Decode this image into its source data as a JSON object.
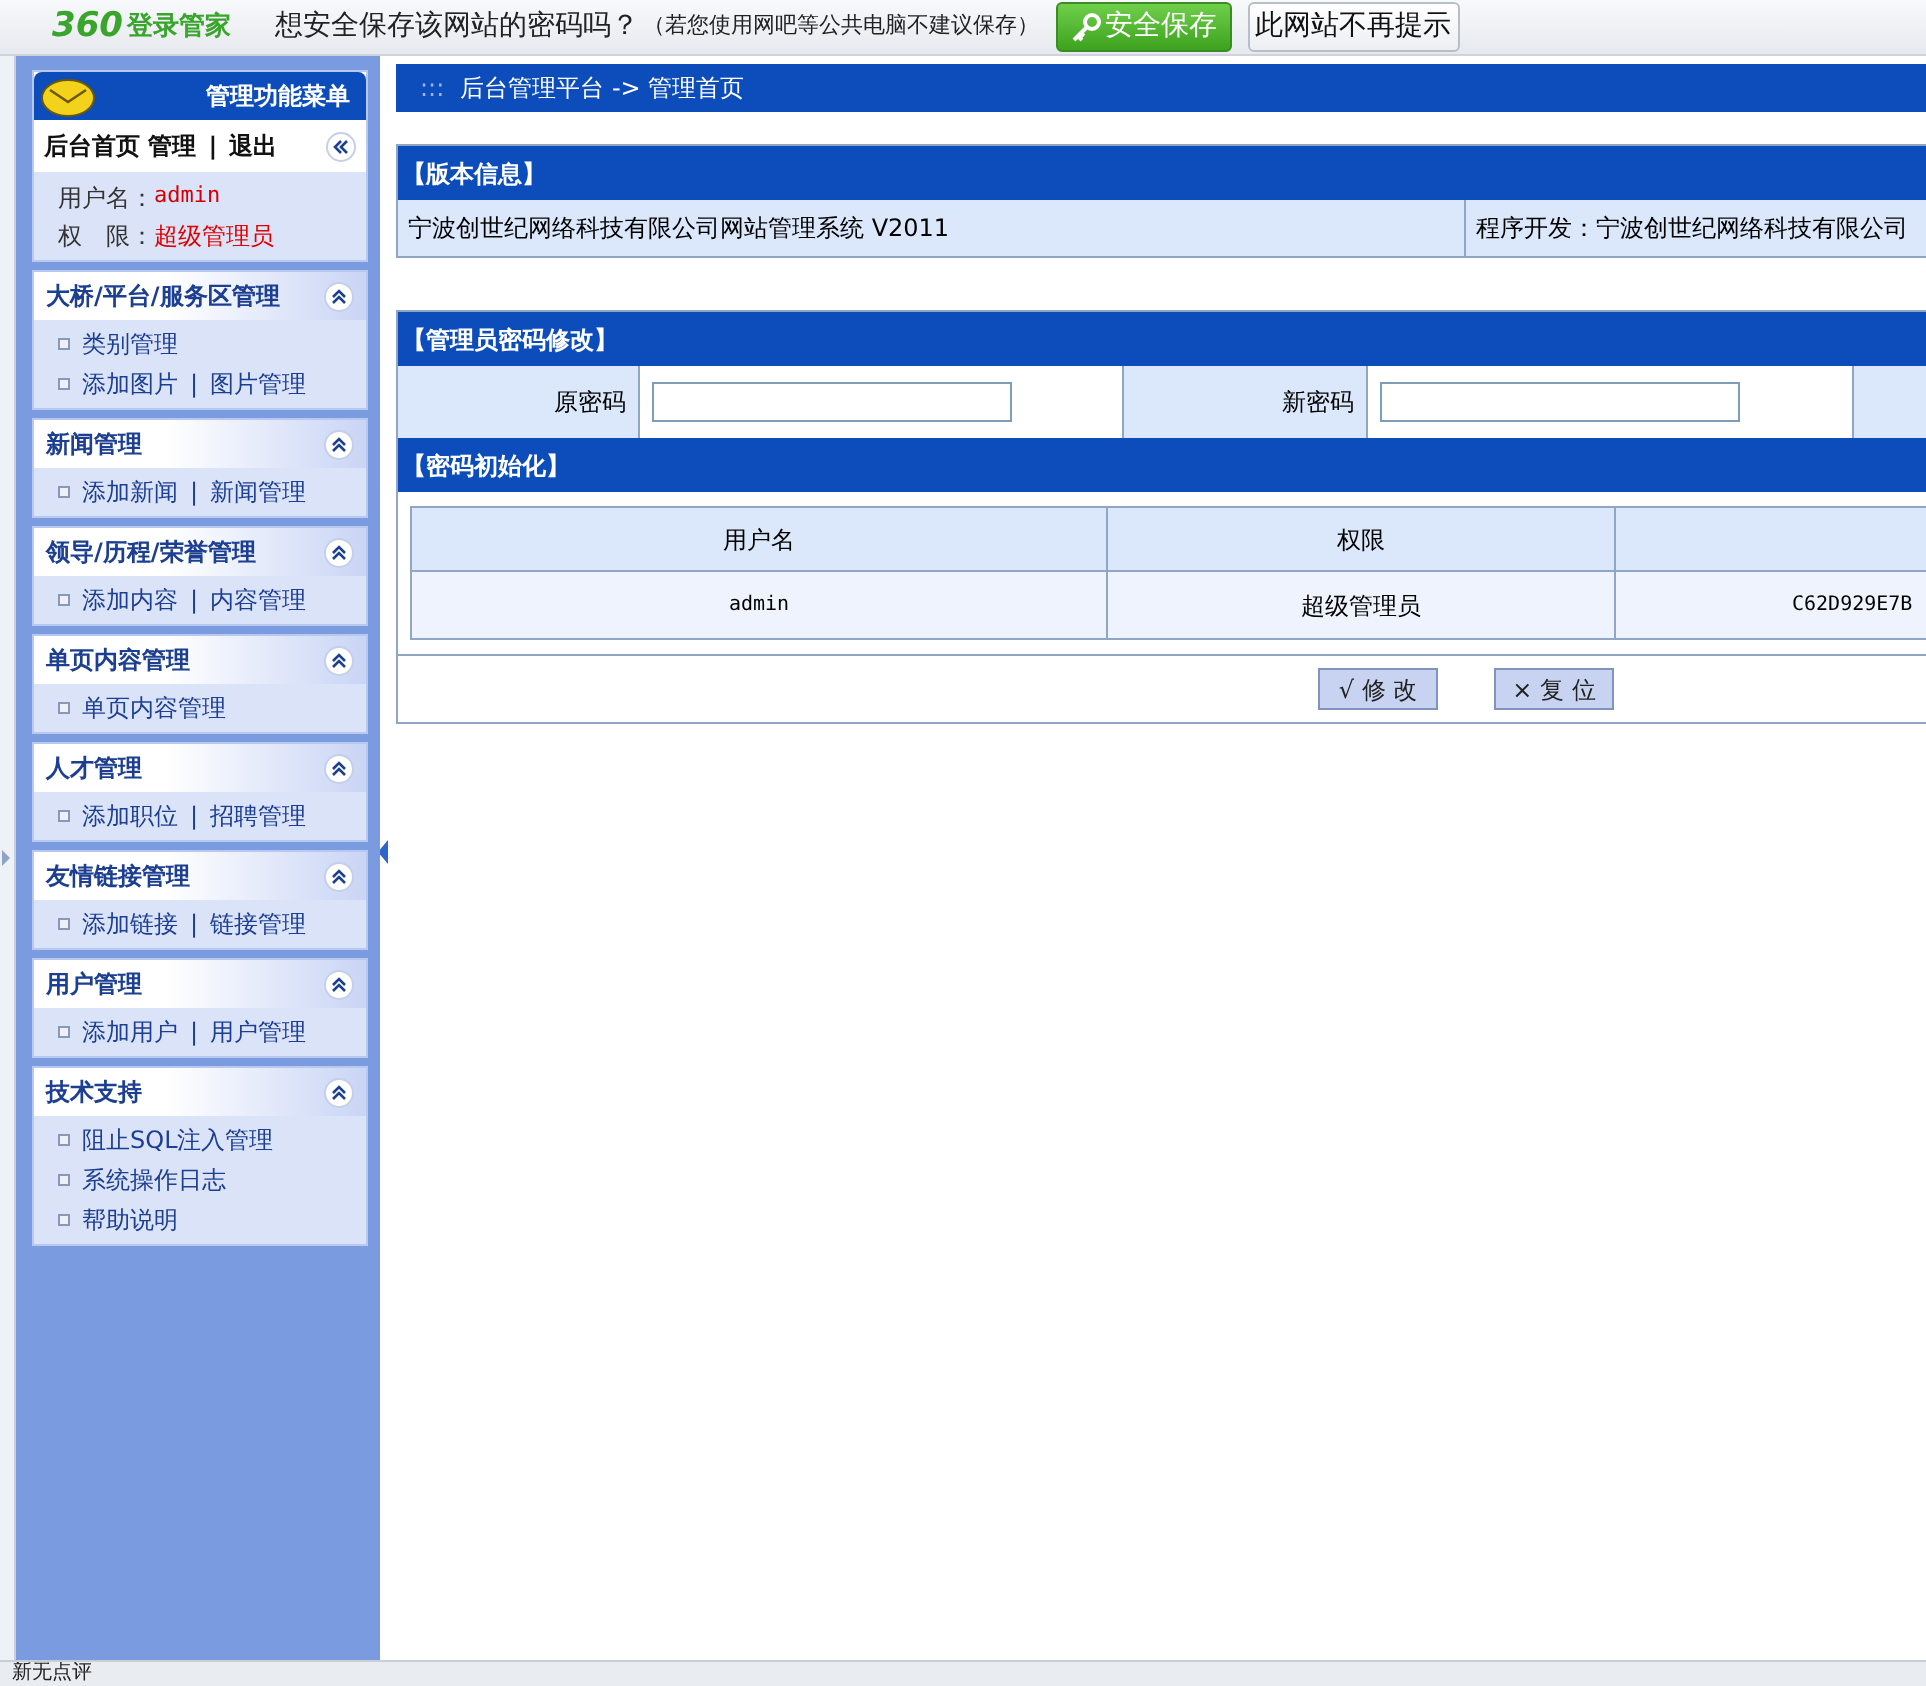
{
  "top_bar": {
    "logo_number": "360",
    "logo_text": "登录管家",
    "prompt": "想安全保存该网站的密码吗？",
    "note": "（若您使用网吧等公共电脑不建议保存）",
    "save_button": "安全保存",
    "dismiss_button": "此网站不再提示"
  },
  "sidebar": {
    "title": "管理功能菜单",
    "home": {
      "links": [
        {
          "text": "后台首页 管理",
          "kind": "link"
        },
        {
          "text": "|",
          "kind": "separator"
        },
        {
          "text": "退出",
          "kind": "link"
        }
      ],
      "user_label": "用户名：",
      "user": "admin",
      "role_label": "权　限：",
      "role": "超级管理员"
    },
    "sections": [
      {
        "title": "大桥/平台/服务区管理",
        "expanded": true,
        "lines": [
          [
            {
              "text": "类别管理",
              "kind": "link"
            }
          ],
          [
            {
              "text": "添加图片",
              "kind": "link"
            },
            {
              "text": "|",
              "kind": "separator"
            },
            {
              "text": "图片管理",
              "kind": "link"
            }
          ]
        ]
      },
      {
        "title": "新闻管理",
        "expanded": true,
        "lines": [
          [
            {
              "text": "添加新闻",
              "kind": "link"
            },
            {
              "text": "|",
              "kind": "separator"
            },
            {
              "text": "新闻管理",
              "kind": "link"
            }
          ]
        ]
      },
      {
        "title": "领导/历程/荣誉管理",
        "expanded": true,
        "lines": [
          [
            {
              "text": "添加内容",
              "kind": "link"
            },
            {
              "text": "|",
              "kind": "separator"
            },
            {
              "text": "内容管理",
              "kind": "link"
            }
          ]
        ]
      },
      {
        "title": "单页内容管理",
        "expanded": true,
        "lines": [
          [
            {
              "text": "单页内容管理",
              "kind": "link"
            }
          ]
        ]
      },
      {
        "title": "人才管理",
        "expanded": true,
        "lines": [
          [
            {
              "text": "添加职位",
              "kind": "link"
            },
            {
              "text": "|",
              "kind": "separator"
            },
            {
              "text": "招聘管理",
              "kind": "link"
            }
          ]
        ]
      },
      {
        "title": "友情链接管理",
        "expanded": true,
        "lines": [
          [
            {
              "text": "添加链接",
              "kind": "link"
            },
            {
              "text": "|",
              "kind": "separator"
            },
            {
              "text": "链接管理",
              "kind": "link"
            }
          ]
        ]
      },
      {
        "title": "用户管理",
        "expanded": true,
        "lines": [
          [
            {
              "text": "添加用户",
              "kind": "link"
            },
            {
              "text": "|",
              "kind": "separator"
            },
            {
              "text": "用户管理",
              "kind": "link"
            }
          ]
        ]
      },
      {
        "title": "技术支持",
        "expanded": true,
        "lines": [
          [
            {
              "text": "阻止SQL注入管理",
              "kind": "link"
            }
          ],
          [
            {
              "text": "系统操作日志",
              "kind": "link"
            }
          ],
          [
            {
              "text": "帮助说明",
              "kind": "link"
            }
          ]
        ]
      }
    ]
  },
  "breadcrumb": {
    "dots": ":::",
    "path": "后台管理平台 -> 管理首页"
  },
  "version_info": {
    "title": "【版本信息】",
    "system": "宁波创世纪网络科技有限公司网站管理系统 V2011",
    "developer": "程序开发：宁波创世纪网络科技有限公司"
  },
  "password_change": {
    "title": "【管理员密码修改】",
    "old_label": "原密码",
    "new_label": "新密码"
  },
  "password_reset": {
    "title": "【密码初始化】",
    "columns": [
      "用户名",
      "权限"
    ],
    "rows": [
      [
        "admin",
        "超级管理员",
        "C62D929E7B"
      ]
    ]
  },
  "buttons": [
    "√ 修 改",
    "× 复 位"
  ],
  "status_bar": {
    "text": "新无点评"
  }
}
